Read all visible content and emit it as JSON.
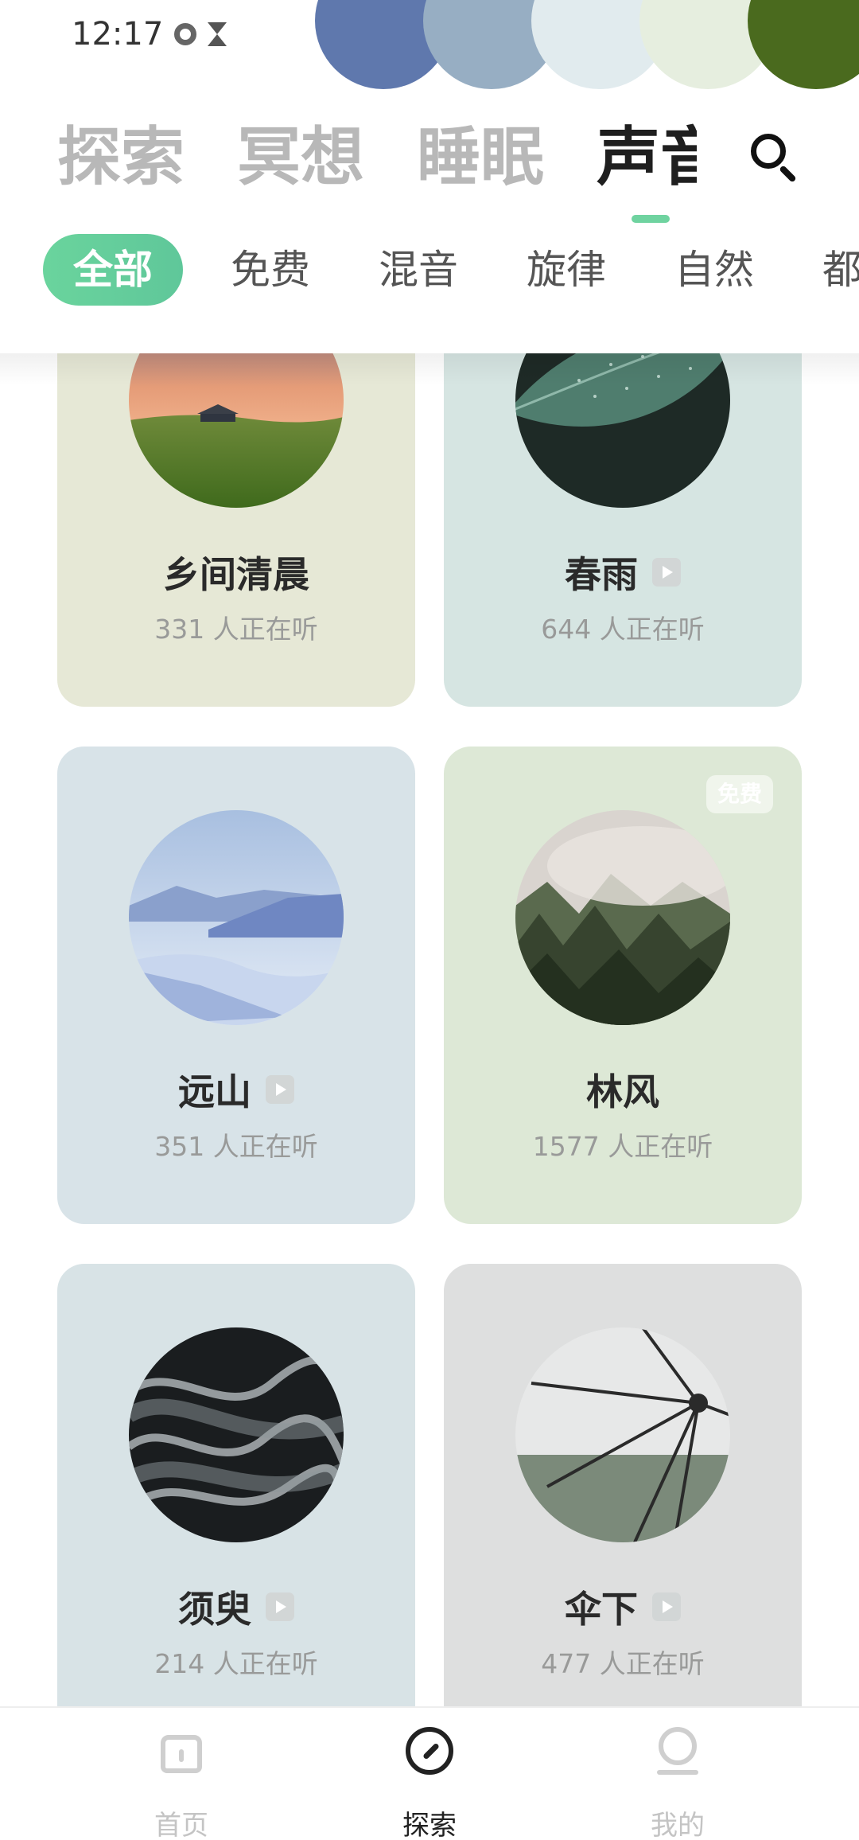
{
  "status_bar": {
    "time": "12:17"
  },
  "palette_colors": [
    "#5f78ad",
    "#97aec3",
    "#e1ebee",
    "#e6eedf",
    "#4a6a1e"
  ],
  "main_tabs": [
    {
      "label": "探索",
      "active": false
    },
    {
      "label": "冥想",
      "active": false
    },
    {
      "label": "睡眠",
      "active": false
    },
    {
      "label": "声音",
      "active": true
    }
  ],
  "sub_tabs": [
    {
      "label": "全部",
      "active": true
    },
    {
      "label": "免费",
      "active": false
    },
    {
      "label": "混音",
      "active": false
    },
    {
      "label": "旋律",
      "active": false
    },
    {
      "label": "自然",
      "active": false
    },
    {
      "label": "都市",
      "active": false
    }
  ],
  "cards": [
    {
      "title": "乡间清晨",
      "listeners": "331 人正在听",
      "bg": "#e6e8d6",
      "play_icon": false,
      "badge": "",
      "image": "meadow"
    },
    {
      "title": "春雨",
      "listeners": "644 人正在听",
      "bg": "#d6e5e2",
      "play_icon": true,
      "badge": "",
      "image": "leaf"
    },
    {
      "title": "远山",
      "listeners": "351 人正在听",
      "bg": "#d8e3e8",
      "play_icon": true,
      "badge": "",
      "image": "mountains"
    },
    {
      "title": "林风",
      "listeners": "1577 人正在听",
      "bg": "#dde8d6",
      "play_icon": false,
      "badge": "免费",
      "image": "forest"
    },
    {
      "title": "须臾",
      "listeners": "214 人正在听",
      "bg": "#d8e3e6",
      "play_icon": true,
      "badge": "",
      "image": "smoke"
    },
    {
      "title": "伞下",
      "listeners": "477 人正在听",
      "bg": "#dedfdf",
      "play_icon": true,
      "badge": "",
      "image": "umbrella"
    }
  ],
  "bottom_nav": [
    {
      "label": "首页",
      "active": false,
      "icon": "home-icon"
    },
    {
      "label": "探索",
      "active": true,
      "icon": "compass-icon"
    },
    {
      "label": "我的",
      "active": false,
      "icon": "profile-icon"
    }
  ],
  "accent_color": "#6fd3a0"
}
